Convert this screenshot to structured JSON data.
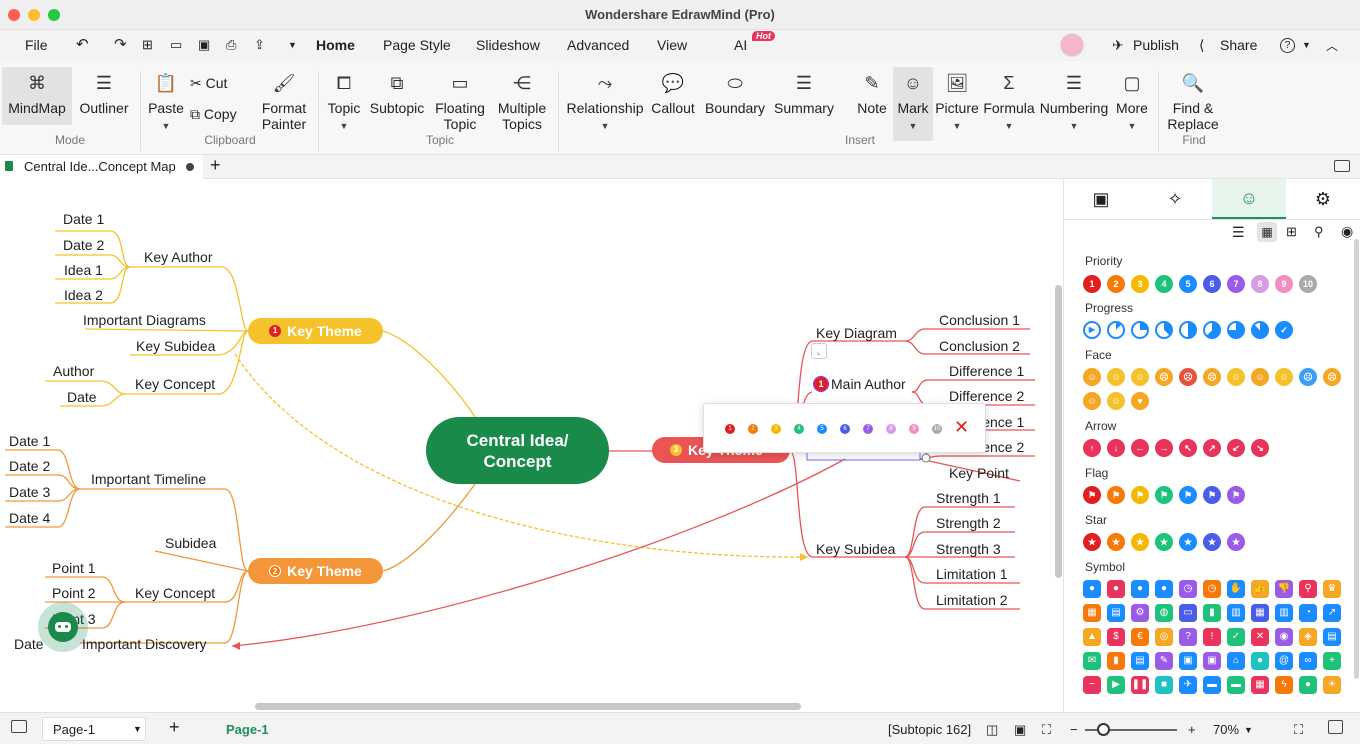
{
  "window": {
    "title": "Wondershare EdrawMind (Pro)"
  },
  "menu": {
    "file": "File",
    "tabs": [
      "Home",
      "Page Style",
      "Slideshow",
      "Advanced",
      "View",
      "AI"
    ],
    "hot": "Hot",
    "publish": "Publish",
    "share": "Share",
    "help": "?"
  },
  "ribbon": {
    "mode": {
      "mindmap": "MindMap",
      "outliner": "Outliner",
      "group": "Mode"
    },
    "clipboard": {
      "paste": "Paste",
      "cut": "Cut",
      "copy": "Copy",
      "format_painter_1": "Format",
      "format_painter_2": "Painter",
      "group": "Clipboard"
    },
    "topic": {
      "topic": "Topic",
      "subtopic": "Subtopic",
      "floating_1": "Floating",
      "floating_2": "Topic",
      "multiple_1": "Multiple",
      "multiple_2": "Topics",
      "group": "Topic"
    },
    "insert": {
      "relationship": "Relationship",
      "callout": "Callout",
      "boundary": "Boundary",
      "summary": "Summary",
      "note": "Note",
      "mark": "Mark",
      "picture": "Picture",
      "formula": "Formula",
      "numbering": "Numbering",
      "more": "More",
      "group": "Insert"
    },
    "find": {
      "find_1": "Find &",
      "find_2": "Replace",
      "group": "Find"
    }
  },
  "doc_tab": {
    "name": "Central Ide...Concept Map"
  },
  "canvas": {
    "central": {
      "line1": "Central Idea/",
      "line2": "Concept"
    },
    "themes": [
      {
        "label": "Key Theme",
        "num": "1"
      },
      {
        "label": "Key Theme",
        "num": "2"
      },
      {
        "label": "Key Theme",
        "num": "3"
      }
    ],
    "left_top": {
      "key_author": "Key Author",
      "dates": [
        "Date 1",
        "Date 2"
      ],
      "ideas": [
        "Idea 1",
        "Idea 2"
      ],
      "important_diagrams": "Important Diagrams",
      "key_subidea": "Key Subidea",
      "key_concept": "Key Concept",
      "author": "Author",
      "date": "Date"
    },
    "left_bottom": {
      "timeline": "Important Timeline",
      "dates": [
        "Date 1",
        "Date 2",
        "Date 3",
        "Date 4"
      ],
      "subidea": "Subidea",
      "key_concept": "Key Concept",
      "points": [
        "Point 1",
        "Point 2",
        "Point 3"
      ],
      "discovery": "Important Discovery",
      "date": "Date"
    },
    "right": {
      "key_diagram": "Key Diagram",
      "conclusions": [
        "Conclusion 1",
        "Conclusion 2"
      ],
      "main_author": "Main Author",
      "differences": [
        "Difference 1",
        "Difference 2",
        "Difference 1",
        "Difference 2"
      ],
      "key_point": "Key Point",
      "key_subidea": "Key Subidea",
      "strengths": [
        "Strength 1",
        "Strength 2",
        "Strength 3"
      ],
      "limitations": [
        "Limitation 1",
        "Limitation 2"
      ],
      "main_author_mark": "1"
    },
    "popup_numbers": [
      "1",
      "2",
      "3",
      "4",
      "5",
      "6",
      "7",
      "8",
      "9",
      "10"
    ]
  },
  "panel": {
    "sections": {
      "priority": "Priority",
      "progress": "Progress",
      "face": "Face",
      "arrow": "Arrow",
      "flag": "Flag",
      "star": "Star",
      "symbol": "Symbol"
    },
    "priority": [
      "1",
      "2",
      "3",
      "4",
      "5",
      "6",
      "7",
      "8",
      "9",
      "10"
    ]
  },
  "status": {
    "page_select": "Page-1",
    "page_tab": "Page-1",
    "selection": "[Subtopic 162]",
    "zoom": "70%"
  },
  "colors": {
    "yellow": "#f5c22b",
    "orange": "#f4973a",
    "red": "#ea5455",
    "green": "#1a8a4a",
    "accent": "#1f8f5f"
  }
}
